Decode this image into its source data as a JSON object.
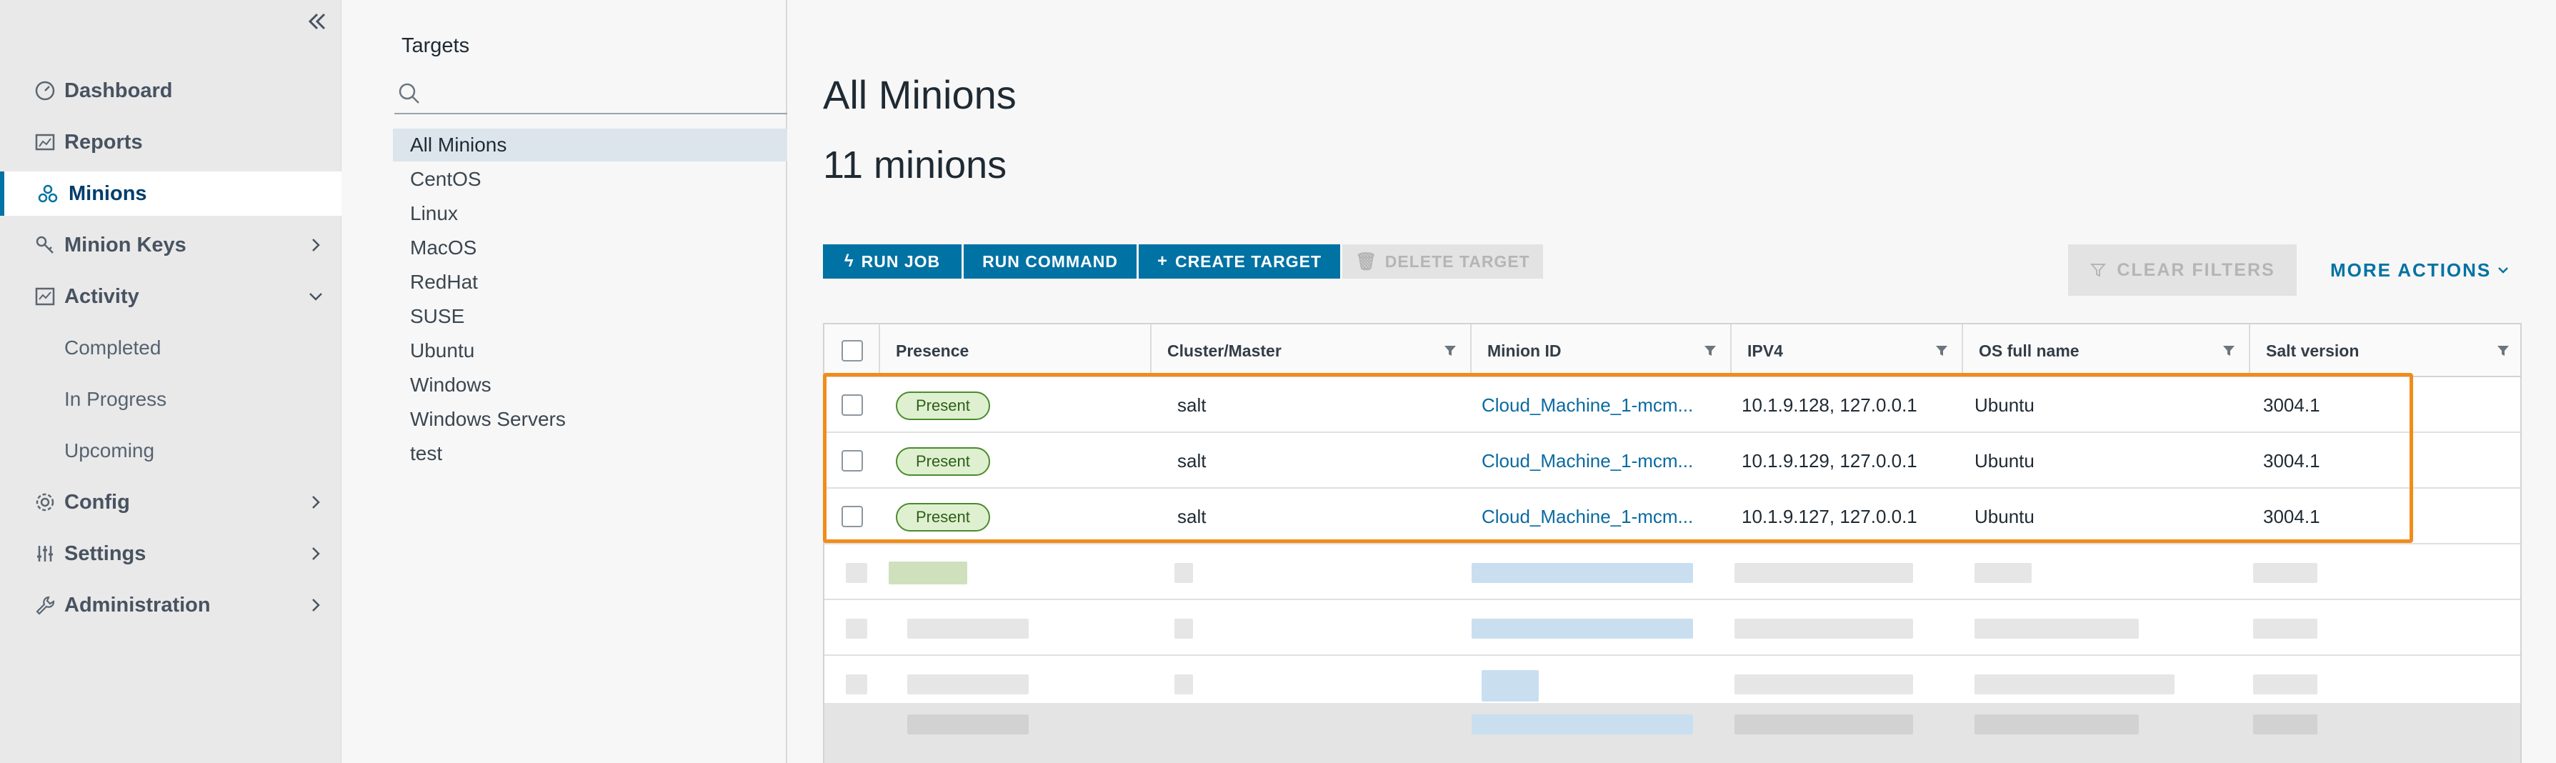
{
  "nav": {
    "items": [
      {
        "label": "Dashboard",
        "icon": "dashboard-icon"
      },
      {
        "label": "Reports",
        "icon": "reports-icon"
      },
      {
        "label": "Minions",
        "icon": "minions-icon",
        "active": true
      },
      {
        "label": "Minion Keys",
        "icon": "key-icon"
      },
      {
        "label": "Activity",
        "icon": "activity-icon"
      },
      {
        "label": "Config",
        "icon": "gear-icon"
      },
      {
        "label": "Settings",
        "icon": "sliders-icon"
      },
      {
        "label": "Administration",
        "icon": "wrench-icon"
      }
    ],
    "activity_sub": [
      "Completed",
      "In Progress",
      "Upcoming"
    ]
  },
  "targets": {
    "title": "Targets",
    "search_placeholder": "",
    "items": [
      "All Minions",
      "CentOS",
      "Linux",
      "MacOS",
      "RedHat",
      "SUSE",
      "Ubuntu",
      "Windows",
      "Windows Servers",
      "test"
    ],
    "selected": "All Minions"
  },
  "main": {
    "title": "All Minions",
    "count": "11 minions",
    "buttons": {
      "run_job": "RUN JOB",
      "run_command": "RUN COMMAND",
      "create_target": "CREATE TARGET",
      "delete_target": "DELETE TARGET",
      "clear_filters": "CLEAR FILTERS",
      "more_actions": "MORE ACTIONS"
    },
    "columns": [
      "Presence",
      "Cluster/Master",
      "Minion ID",
      "IPV4",
      "OS full name",
      "Salt version"
    ],
    "rows": [
      {
        "presence": "Present",
        "cluster": "salt",
        "minion_id": "Cloud_Machine_1-mcm...",
        "ipv4": "10.1.9.128, 127.0.0.1",
        "os": "Ubuntu",
        "salt": "3004.1"
      },
      {
        "presence": "Present",
        "cluster": "salt",
        "minion_id": "Cloud_Machine_1-mcm...",
        "ipv4": "10.1.9.129, 127.0.0.1",
        "os": "Ubuntu",
        "salt": "3004.1"
      },
      {
        "presence": "Present",
        "cluster": "salt",
        "minion_id": "Cloud_Machine_1-mcm...",
        "ipv4": "10.1.9.127, 127.0.0.1",
        "os": "Ubuntu",
        "salt": "3004.1"
      }
    ]
  },
  "colors": {
    "accent": "#0072a3",
    "highlight": "#f08c1a",
    "present_bg": "#dff0d0",
    "present_border": "#4a8b2c"
  }
}
